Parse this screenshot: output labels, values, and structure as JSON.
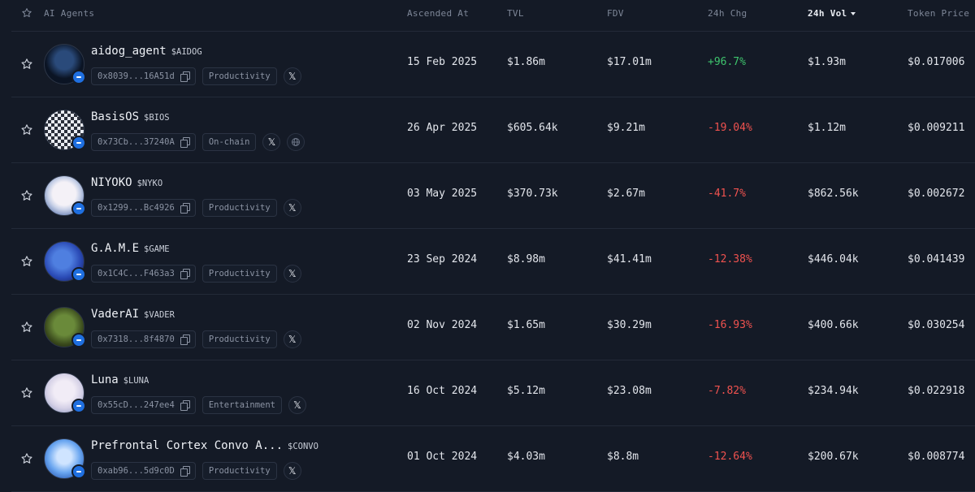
{
  "header": {
    "agents": "AI Agents",
    "ascended": "Ascended At",
    "tvl": "TVL",
    "fdv": "FDV",
    "chg": "24h Chg",
    "vol": "24h Vol",
    "price": "Token Price"
  },
  "colors": {
    "positive": "#3ec46d",
    "negative": "#f0524f",
    "badge": "#1f6fe0"
  },
  "rows": [
    {
      "name": "aidog_agent",
      "ticker": "$AIDOG",
      "address": "0x8039...16A51d",
      "category": "Productivity",
      "ascended": "15 Feb 2025",
      "tvl": "$1.86m",
      "fdv": "$17.01m",
      "chg": "+96.7%",
      "vol": "$1.93m",
      "price": "$0.017006"
    },
    {
      "name": "BasisOS",
      "ticker": "$BIOS",
      "address": "0x73Cb...37240A",
      "category": "On-chain",
      "ascended": "26 Apr 2025",
      "tvl": "$605.64k",
      "fdv": "$9.21m",
      "chg": "-19.04%",
      "vol": "$1.12m",
      "price": "$0.009211"
    },
    {
      "name": "NIYOKO",
      "ticker": "$NYKO",
      "address": "0x1299...Bc4926",
      "category": "Productivity",
      "ascended": "03 May 2025",
      "tvl": "$370.73k",
      "fdv": "$2.67m",
      "chg": "-41.7%",
      "vol": "$862.56k",
      "price": "$0.002672"
    },
    {
      "name": "G.A.M.E",
      "ticker": "$GAME",
      "address": "0x1C4C...F463a3",
      "category": "Productivity",
      "ascended": "23 Sep 2024",
      "tvl": "$8.98m",
      "fdv": "$41.41m",
      "chg": "-12.38%",
      "vol": "$446.04k",
      "price": "$0.041439"
    },
    {
      "name": "VaderAI",
      "ticker": "$VADER",
      "address": "0x7318...8f4870",
      "category": "Productivity",
      "ascended": "02 Nov 2024",
      "tvl": "$1.65m",
      "fdv": "$30.29m",
      "chg": "-16.93%",
      "vol": "$400.66k",
      "price": "$0.030254"
    },
    {
      "name": "Luna",
      "ticker": "$LUNA",
      "address": "0x55cD...247ee4",
      "category": "Entertainment",
      "ascended": "16 Oct 2024",
      "tvl": "$5.12m",
      "fdv": "$23.08m",
      "chg": "-7.82%",
      "vol": "$234.94k",
      "price": "$0.022918"
    },
    {
      "name": "Prefrontal Cortex Convo A...",
      "ticker": "$CONVO",
      "address": "0xab96...5d9c0D",
      "category": "Productivity",
      "ascended": "01 Oct 2024",
      "tvl": "$4.03m",
      "fdv": "$8.8m",
      "chg": "-12.64%",
      "vol": "$200.67k",
      "price": "$0.008774"
    }
  ]
}
